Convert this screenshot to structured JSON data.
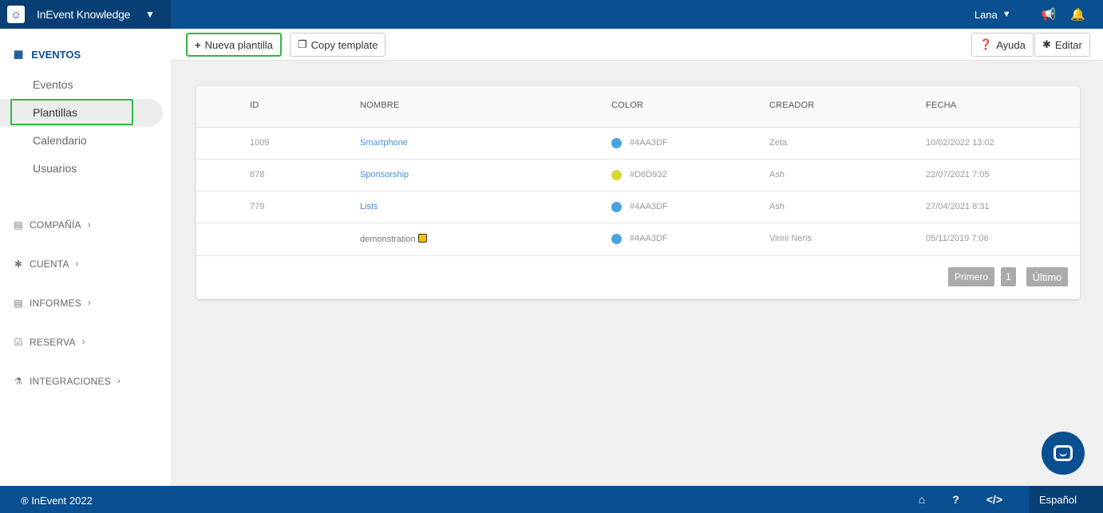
{
  "topbar": {
    "app_name": "InEvent Knowledge",
    "user_name": "Lana",
    "icons": [
      "chevron-down-icon",
      "megaphone-icon",
      "bell-icon"
    ]
  },
  "sidebar": {
    "section_title": "EVENTOS",
    "items": [
      {
        "label": "Eventos"
      },
      {
        "label": "Plantillas",
        "active": true
      },
      {
        "label": "Calendario"
      },
      {
        "label": "Usuarios"
      }
    ],
    "groups": [
      {
        "label": "COMPAÑÍA",
        "icon": "building-icon"
      },
      {
        "label": "CUENTA",
        "icon": "gear-icon"
      },
      {
        "label": "INFORMES",
        "icon": "building-icon"
      },
      {
        "label": "RESERVA",
        "icon": "calendar-check-icon"
      },
      {
        "label": "INTEGRACIONES",
        "icon": "flask-icon"
      }
    ]
  },
  "toolbar": {
    "new_template": "Nueva plantilla",
    "copy_template": "Copy template",
    "help": "Ayuda",
    "edit": "Editar"
  },
  "table": {
    "headers": {
      "id": "ID",
      "name": "NOMBRE",
      "color": "COLOR",
      "creator": "CREADOR",
      "date": "FECHA"
    },
    "rows": [
      {
        "id": "1009",
        "name": "Smartphone",
        "color": "#4AA3DF",
        "creator": "Zeta",
        "date": "10/02/2022 13:02"
      },
      {
        "id": "878",
        "name": "Sponsorship",
        "color": "#D6D932",
        "creator": "Ash",
        "date": "22/07/2021 7:05"
      },
      {
        "id": "779",
        "name": "Lists",
        "color": "#4AA3DF",
        "creator": "Ash",
        "date": "27/04/2021 8:31"
      },
      {
        "id": "",
        "name": "demonstration",
        "color": "#4AA3DF",
        "creator": "Vinni Neris",
        "date": "05/11/2019 7:06",
        "locked": true
      }
    ]
  },
  "pagination": {
    "first": "Primero",
    "page": "1",
    "last": "Último"
  },
  "footer": {
    "copyright": "® InEvent 2022",
    "language": "Español"
  }
}
